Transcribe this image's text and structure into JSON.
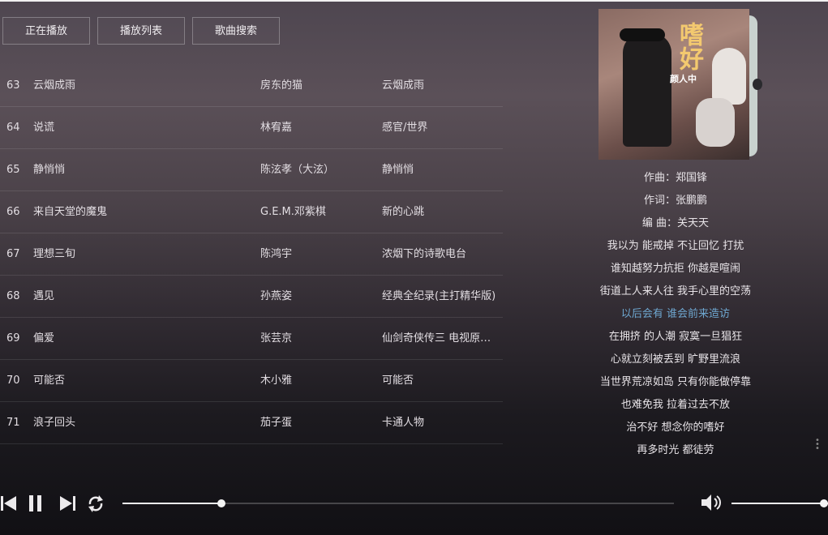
{
  "tabs": [
    "正在播放",
    "播放列表",
    "歌曲搜索"
  ],
  "songs": [
    {
      "num": "63",
      "title": "云烟成雨",
      "artist": "房东的猫",
      "album": "云烟成雨"
    },
    {
      "num": "64",
      "title": "说谎",
      "artist": "林宥嘉",
      "album": "感官/世界"
    },
    {
      "num": "65",
      "title": "静悄悄",
      "artist": "陈泫孝（大泫）",
      "album": "静悄悄"
    },
    {
      "num": "66",
      "title": "来自天堂的魔鬼",
      "artist": "G.E.M.邓紫棋",
      "album": "新的心跳"
    },
    {
      "num": "67",
      "title": "理想三旬",
      "artist": "陈鸿宇",
      "album": "浓烟下的诗歌电台"
    },
    {
      "num": "68",
      "title": "遇见",
      "artist": "孙燕姿",
      "album": "经典全纪录(主打精华版)"
    },
    {
      "num": "69",
      "title": "偏爱",
      "artist": "张芸京",
      "album": "仙剑奇侠传三 电视原声带"
    },
    {
      "num": "70",
      "title": "可能否",
      "artist": "木小雅",
      "album": "可能否"
    },
    {
      "num": "71",
      "title": "浪子回头",
      "artist": "茄子蛋",
      "album": "卡通人物"
    }
  ],
  "cover": {
    "title": "嗜好",
    "artist": "颜人中"
  },
  "lyrics": [
    "作曲：郑国锋",
    "作词：张鹏鹏",
    "编 曲：关天天",
    "我以为 能戒掉 不让回忆 打扰",
    "谁知越努力抗拒 你越是喧闹",
    "街道上人来人往 我手心里的空荡",
    "以后会有 谁会前来造访",
    "在拥挤 的人潮 寂寞一旦猖狂",
    "心就立刻被丢到 旷野里流浪",
    "当世界荒凉如岛 只有你能做停靠",
    "也难免我 拉着过去不放",
    "治不好 想念你的嗜好",
    "再多时光 都徒劳"
  ],
  "active_lyric_index": 6,
  "player": {
    "progress": 0.18,
    "volume": 1.0,
    "icons": [
      "previous-icon",
      "pause-icon",
      "next-icon",
      "loop-icon",
      "volume-icon"
    ]
  },
  "colors": {
    "active_lyric": "#6ea7d0",
    "accent": "#f2f2f2"
  }
}
